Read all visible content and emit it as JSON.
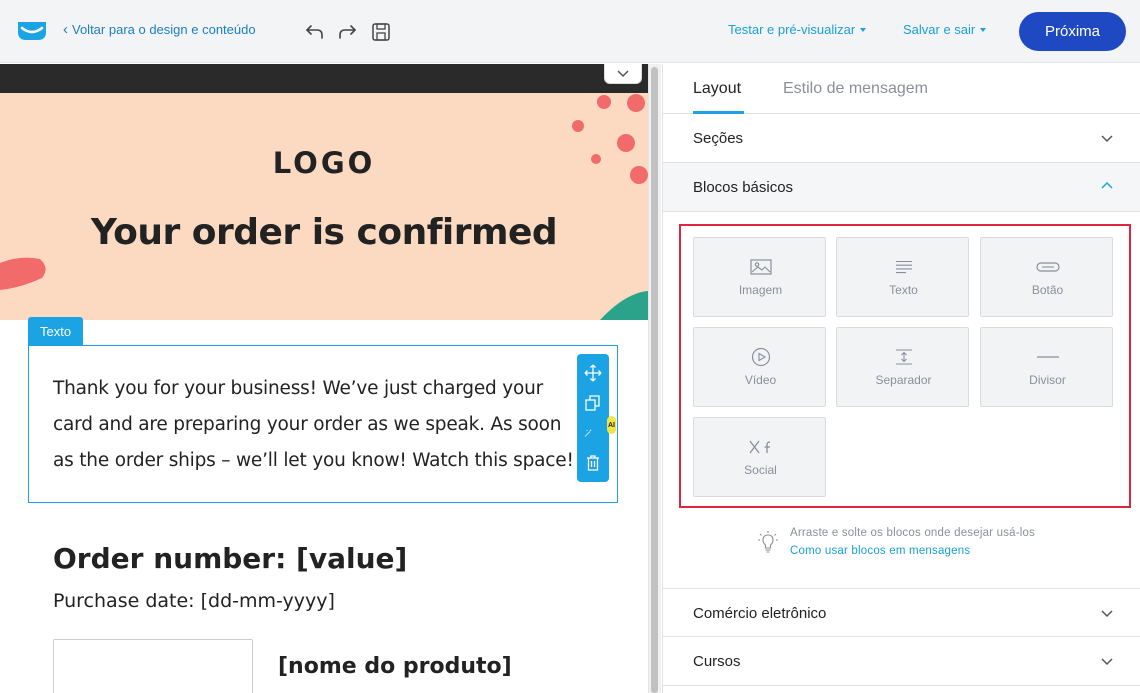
{
  "header": {
    "back_label": "Voltar para o design e conteúdo",
    "preview_label": "Testar e pré-visualizar",
    "save_label": "Salvar e sair",
    "next_label": "Próxima"
  },
  "email": {
    "logo": "LOGO",
    "hero_title": "Your order is confirmed",
    "text_tag": "Texto",
    "body_text": "Thank you for your business! We’ve just charged your card and are preparing your order as we speak. As soon as the order ships – we’ll let you know! Watch this space!",
    "ai_badge": "AI",
    "order_number": "Order number: [value]",
    "purchase_date": "Purchase date: [dd-mm-yyyy]",
    "product_name": "[nome do produto]"
  },
  "panel": {
    "tabs": [
      {
        "label": "Layout",
        "active": true
      },
      {
        "label": "Estilo de mensagem",
        "active": false
      }
    ],
    "sections_label": "Seções",
    "basic_blocks_label": "Blocos básicos",
    "blocks": [
      {
        "label": "Imagem",
        "icon": "image-icon"
      },
      {
        "label": "Texto",
        "icon": "text-icon"
      },
      {
        "label": "Botão",
        "icon": "button-icon"
      },
      {
        "label": "Vídeo",
        "icon": "video-icon"
      },
      {
        "label": "Separador",
        "icon": "spacer-icon"
      },
      {
        "label": "Divisor",
        "icon": "divider-icon"
      },
      {
        "label": "Social",
        "icon": "social-icon"
      }
    ],
    "hint_text": "Arraste e solte os blocos onde desejar usá-los",
    "hint_link": "Como usar blocos em mensagens",
    "ecommerce_label": "Comércio eletrônico",
    "courses_label": "Cursos"
  },
  "colors": {
    "accent": "#1ba3e4",
    "primary_button": "#1e49c2",
    "hero_bg": "#fcdac2",
    "highlight_frame": "#e0263c"
  }
}
